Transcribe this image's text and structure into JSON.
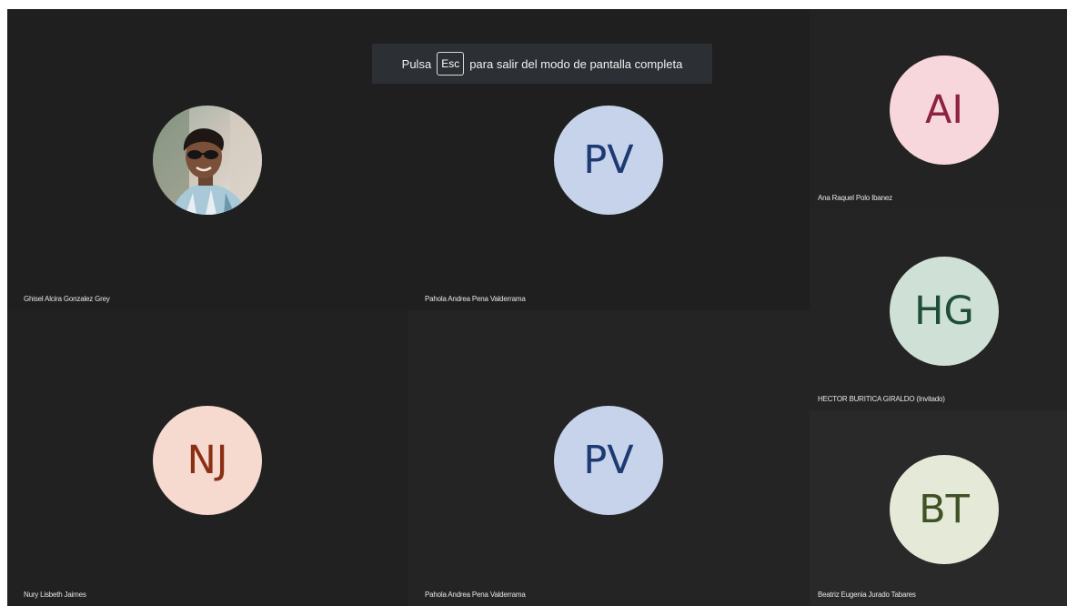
{
  "fullscreen_banner": {
    "prefix": "Pulsa",
    "key": "Esc",
    "suffix": "para salir del modo de pantalla completa"
  },
  "participants": {
    "main": [
      {
        "name": "Ghisel Alcira Gonzalez Grey",
        "type": "photo"
      },
      {
        "name": "Pahola Andrea Pena Valderrama",
        "initials": "PV",
        "avatar_bg": "#c7d3eb",
        "avatar_fg": "#1d3a73"
      },
      {
        "name": "Nury Lisbeth Jaimes",
        "initials": "NJ",
        "avatar_bg": "#f6d9cf",
        "avatar_fg": "#8a2f14"
      },
      {
        "name": "Pahola Andrea Pena Valderrama",
        "initials": "PV",
        "avatar_bg": "#c7d3eb",
        "avatar_fg": "#1d3a73"
      }
    ],
    "side": [
      {
        "name": "Ana Raquel Polo Ibanez",
        "initials": "AI",
        "avatar_bg": "#f7d6dc",
        "avatar_fg": "#8c2340"
      },
      {
        "name": "HECTOR BURITICA GIRALDO (Invitado)",
        "initials": "HG",
        "avatar_bg": "#cfe0d6",
        "avatar_fg": "#1f4e36"
      },
      {
        "name": "Beatriz Eugenia Jurado Tabares",
        "initials": "BT",
        "avatar_bg": "#e5ead8",
        "avatar_fg": "#3f5226"
      }
    ]
  }
}
